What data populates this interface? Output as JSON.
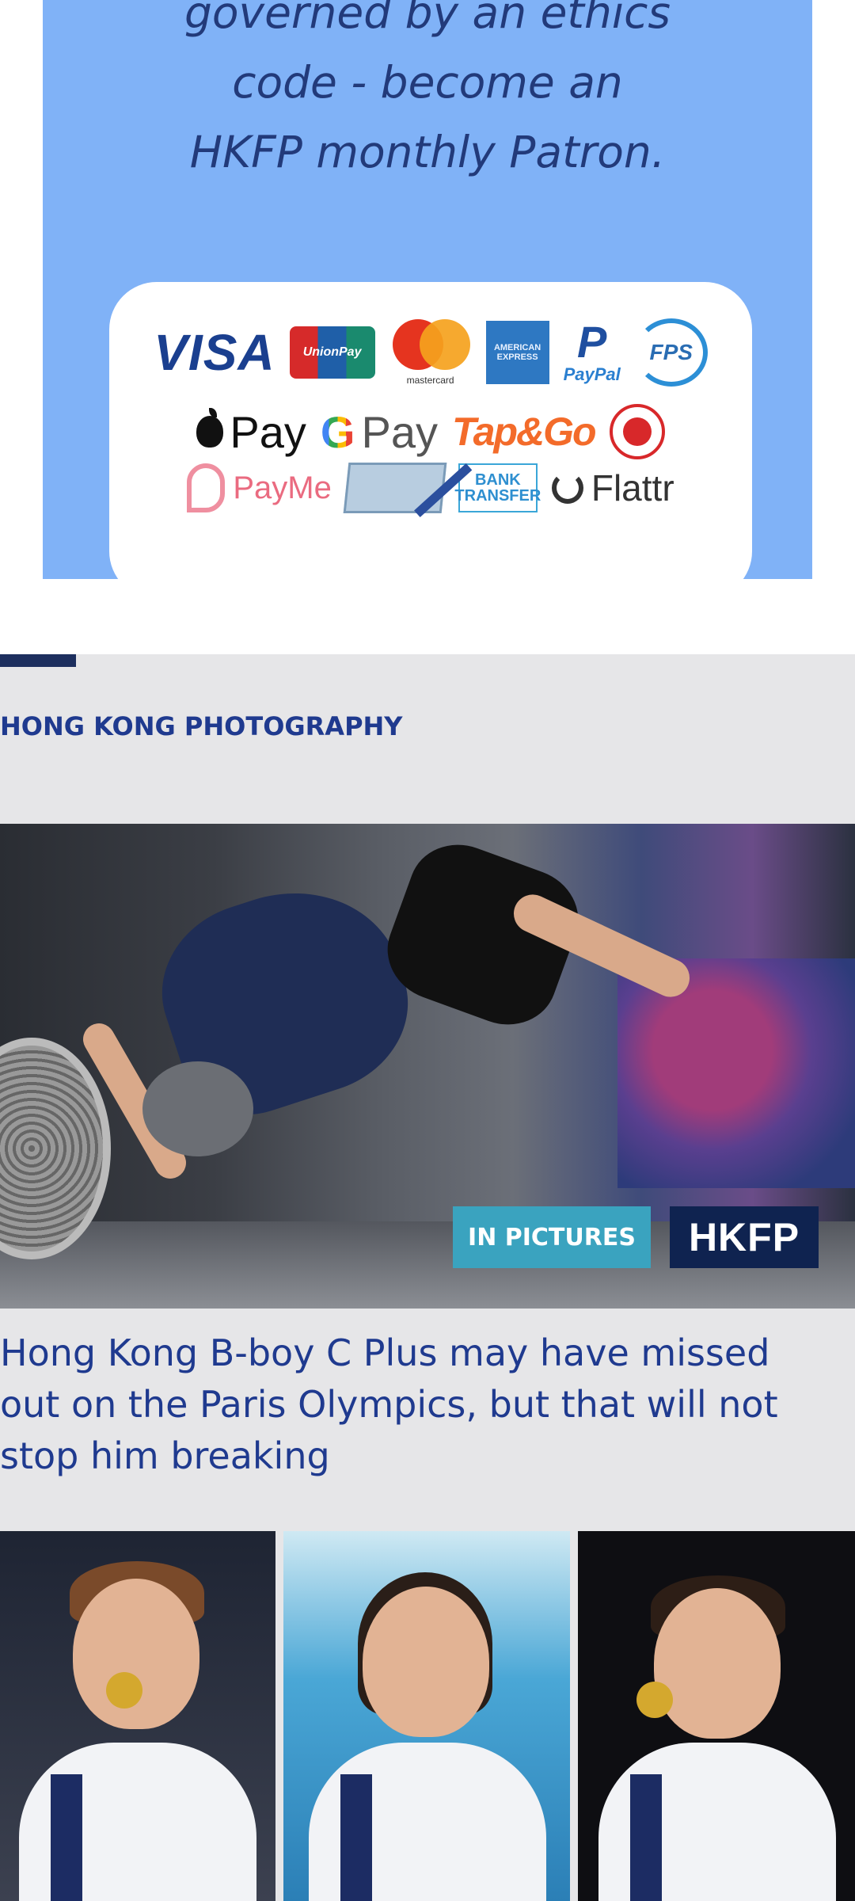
{
  "promo": {
    "lines": [
      "governed by an ethics",
      "code - become an",
      "HKFP monthly Patron."
    ],
    "payment_methods": {
      "visa": "VISA",
      "unionpay": "UnionPay",
      "mastercard": "mastercard",
      "amex": "AMERICAN EXPRESS",
      "paypal": "PayPal",
      "fps": "FPS",
      "applepay": "Pay",
      "googlepay_g": "G",
      "googlepay": "Pay",
      "tapgo": "Tap&Go",
      "payme": "PayMe",
      "bank_transfer": "BANK TRANSFER",
      "flattr": "Flattr"
    },
    "background_color": "#80b2f7"
  },
  "section": {
    "label": "HONG KONG PHOTOGRAPHY",
    "accent_color": "#1d2f5e",
    "label_color": "#1f3a8f"
  },
  "article": {
    "badge_in_pictures": "IN PICTURES",
    "badge_brand": "HKFP",
    "headline": "Hong Kong B-boy C Plus may have missed out on the Paris Olympics, but that will not stop him breaking"
  }
}
